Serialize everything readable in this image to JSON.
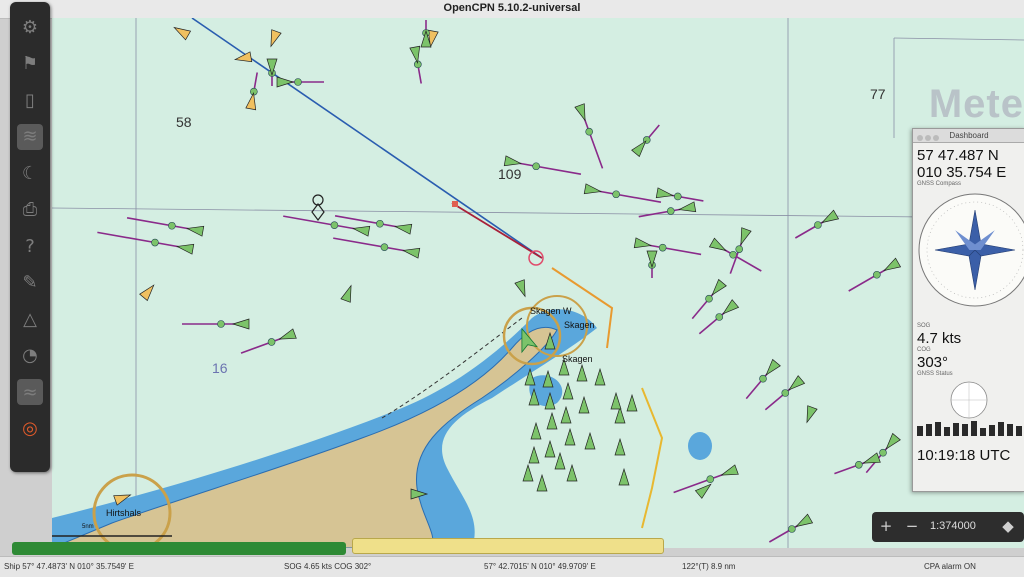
{
  "window": {
    "title": "OpenCPN 5.10.2-universal"
  },
  "toolbar": {
    "tools": [
      {
        "name": "settings-tool",
        "glyph": "⚙"
      },
      {
        "name": "route-tool",
        "glyph": "⚑"
      },
      {
        "name": "tracks-tool",
        "glyph": "▯"
      },
      {
        "name": "ais-tool",
        "glyph": "≋"
      },
      {
        "name": "tides-tool",
        "glyph": "☾"
      },
      {
        "name": "print-tool",
        "glyph": "⎙"
      },
      {
        "name": "help-tool",
        "glyph": "?"
      },
      {
        "name": "measure-tool",
        "glyph": "✎"
      },
      {
        "name": "alert-tool",
        "glyph": "△"
      },
      {
        "name": "mob-tool",
        "glyph": "◔"
      },
      {
        "name": "waves-tool",
        "glyph": "≈"
      },
      {
        "name": "lifebuoy-tool",
        "glyph": "◎"
      }
    ]
  },
  "chart": {
    "depths": [
      {
        "label": "58",
        "id": "depth-58"
      },
      {
        "label": "109",
        "id": "depth-109"
      },
      {
        "label": "77",
        "id": "depth-77"
      },
      {
        "label": "16",
        "id": "depth-16"
      }
    ],
    "places": {
      "skagen_w": "Skagen W",
      "skagen": "Skagen",
      "skagen_town": "Skagen",
      "hirtshals": "Hirtshals"
    },
    "watermark": "Mete",
    "colors": {
      "sea": "#d4eee2",
      "shallow": "#5aa7dc",
      "land": "#d6c494",
      "ais_target": "#7cc36a",
      "cog_line": "#8a2a8a",
      "route": "#2a5db0",
      "scale_bar": "5nm"
    }
  },
  "dashboard": {
    "title": "Dashboard",
    "lat": "57 47.487 N",
    "lon": "010 35.754 E",
    "compass_label": "GNSS Compass",
    "sog_label": "SOG",
    "sog": "4.7 kts",
    "cog_label": "COG",
    "cog": "303°",
    "gnss_label": "GNSS Status",
    "utc": "10:19:18 UTC"
  },
  "zoom": {
    "zoom_in": "+",
    "zoom_out": "−",
    "scale": "1:374000"
  },
  "status": {
    "ship": "Ship 57° 47.4873' N   010° 35.7549' E",
    "sog_cog": "SOG 4.65 kts  COG 302°",
    "cursor": "57° 42.7015' N   010° 49.9709' E",
    "bearing": "122°(T)   8.9 nm",
    "cpa": "CPA alarm ON"
  }
}
